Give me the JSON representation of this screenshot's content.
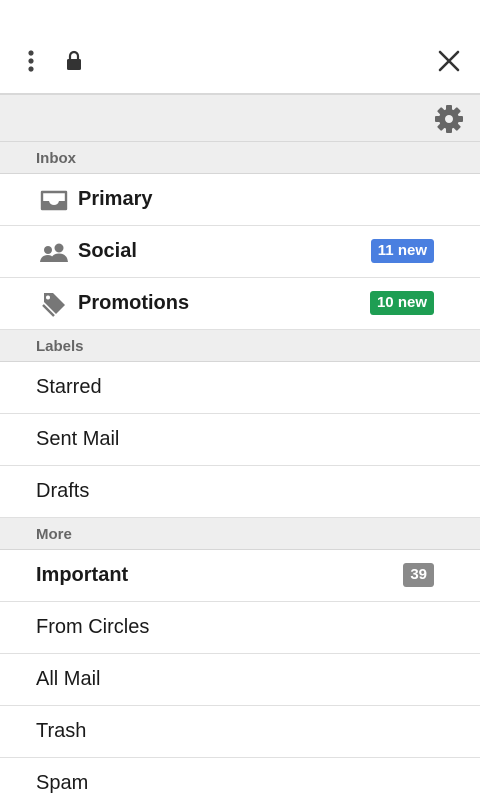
{
  "header": {
    "menu_icon": "more-vert-icon",
    "lock_icon": "lock-icon",
    "close_icon": "close-icon",
    "settings_icon": "gear-icon"
  },
  "inbox": {
    "section_label": "Inbox",
    "items": [
      {
        "label": "Primary",
        "icon": "inbox-tray-icon",
        "badge": ""
      },
      {
        "label": "Social",
        "icon": "people-icon",
        "badge": "11 new",
        "badge_color": "#4a7fe0"
      },
      {
        "label": "Promotions",
        "icon": "tag-icon",
        "badge": "10 new",
        "badge_color": "#1e9e53"
      }
    ]
  },
  "labels": {
    "section_label": "Labels",
    "items": [
      "Starred",
      "Sent Mail",
      "Drafts"
    ]
  },
  "more": {
    "section_label": "More",
    "important": {
      "label": "Important",
      "count": "39",
      "badge_color": "#8a8a8a"
    },
    "items": [
      "From Circles",
      "All Mail",
      "Trash",
      "Spam"
    ]
  }
}
